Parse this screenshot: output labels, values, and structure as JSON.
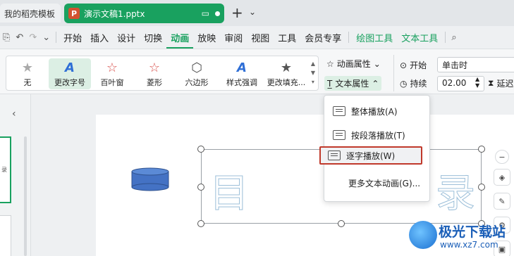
{
  "tabs": {
    "prev_label": "我的稻壳模板",
    "active_badge": "P",
    "active_title": "演示文稿1.pptx",
    "new_tab": "+"
  },
  "menu": {
    "items": [
      "开始",
      "插入",
      "设计",
      "切换",
      "动画",
      "放映",
      "审阅",
      "视图",
      "工具",
      "会员专享"
    ],
    "active": "动画",
    "drawing_tools": "绘图工具",
    "text_tools": "文本工具"
  },
  "ribbon": {
    "gallery": [
      "无",
      "更改字号",
      "百叶窗",
      "菱形",
      "六边形",
      "样式强调",
      "更改填充..."
    ],
    "selected": "更改字号",
    "anim_props": "动画属性",
    "text_props": "文本属性",
    "start_label": "开始",
    "start_value": "单击时",
    "duration_label": "持续",
    "duration_value": "02.00",
    "delay_label": "延迟"
  },
  "dropdown": {
    "items": [
      "整体播放(A)",
      "按段落播放(T)",
      "逐字播放(W)",
      "更多文本动画(G)..."
    ],
    "highlighted": "逐字播放(W)"
  },
  "slide": {
    "char1": "目",
    "char2": "录"
  },
  "watermark": {
    "name": "极光下载站",
    "url": "www.xz7.com"
  },
  "colors": {
    "accent": "#19a15f",
    "highlight_border": "#c0392b",
    "shape_fill": "#4472c4"
  }
}
